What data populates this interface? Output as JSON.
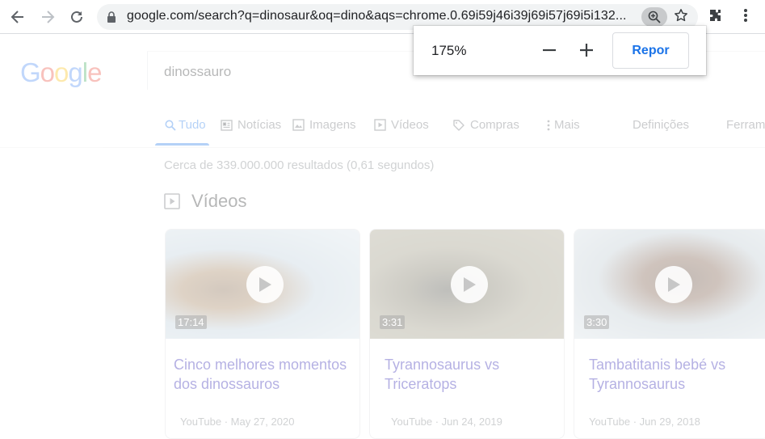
{
  "browser": {
    "url": "google.com/search?q=dinosaur&oq=dino&aqs=chrome.0.69i59j46i39j69i57j69i5i132...",
    "icons": [
      "back-arrow-icon",
      "forward-arrow-icon",
      "reload-icon",
      "lock-icon",
      "zoom-icon",
      "star-icon",
      "extensions-icon",
      "menu-icon"
    ]
  },
  "zoom_popup": {
    "level": "175%",
    "reset_label": "Repor"
  },
  "google": {
    "logo_letters": [
      "G",
      "o",
      "o",
      "g",
      "l",
      "e"
    ],
    "logo_colors": [
      "#4285F4",
      "#EA4335",
      "#FBBC05",
      "#4285F4",
      "#34A853",
      "#EA4335"
    ],
    "query": "dinossauro",
    "tabs": [
      {
        "label": "Tudo",
        "icon": "search-icon",
        "active": true
      },
      {
        "label": "Notícias",
        "icon": "news-icon"
      },
      {
        "label": "Imagens",
        "icon": "image-icon"
      },
      {
        "label": "Vídeos",
        "icon": "video-icon"
      },
      {
        "label": "Compras",
        "icon": "tag-icon"
      },
      {
        "label": "Mais",
        "icon": "more-icon"
      },
      {
        "label": "Definições"
      },
      {
        "label": "Ferram"
      }
    ],
    "stats": "Cerca de 339.000.000 resultados (0,61 segundos)",
    "videos_heading": "Vídeos",
    "videos": [
      {
        "duration": "17:14",
        "title": "Cinco melhores momentos dos dinossauros",
        "source": "YouTube",
        "date": "May 27, 2020"
      },
      {
        "duration": "3:31",
        "title": "Tyrannosaurus vs Triceratops",
        "source": "YouTube",
        "date": "Jun 24, 2019"
      },
      {
        "duration": "3:30",
        "title": "Tambatitanis bebé vs Tyrannosaurus",
        "source": "YouTube",
        "date": "Jun 29, 2018"
      }
    ]
  }
}
